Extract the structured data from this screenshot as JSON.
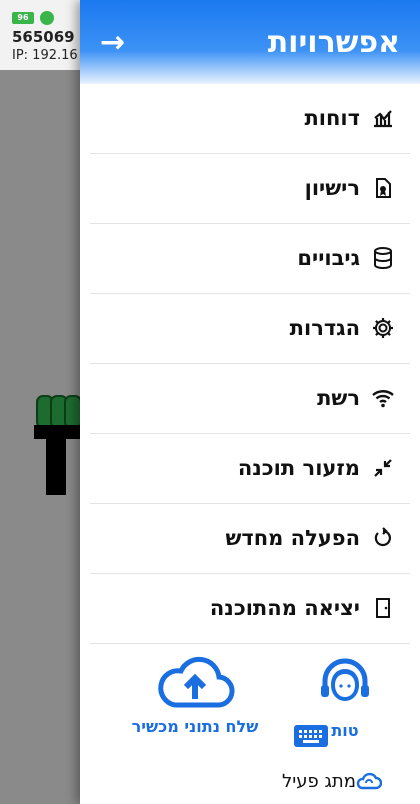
{
  "background": {
    "battery": "96",
    "id_text": "565069",
    "ip_text": "IP: 192.16"
  },
  "drawer": {
    "title": "אפשרויות",
    "back_arrow": "→",
    "menu": [
      {
        "label": "דוחות",
        "icon": "reports-chart-icon"
      },
      {
        "label": "רישיון",
        "icon": "license-document-icon"
      },
      {
        "label": "גיבויים",
        "icon": "database-backup-icon"
      },
      {
        "label": "הגדרות",
        "icon": "gear-icon"
      },
      {
        "label": "רשת",
        "icon": "wifi-icon"
      },
      {
        "label": "מזעור תוכנה",
        "icon": "minimize-icon"
      },
      {
        "label": "הפעלה מחדש",
        "icon": "restart-icon"
      },
      {
        "label": "יציאה מהתוכנה",
        "icon": "exit-icon"
      }
    ],
    "actions": {
      "send_label": "שלח נתוני מכשיר",
      "support_label": "טות"
    },
    "footer": {
      "status_label": "מתג פעיל"
    }
  },
  "colors": {
    "accent": "#1a6ee0",
    "header": "#1b79f0"
  }
}
